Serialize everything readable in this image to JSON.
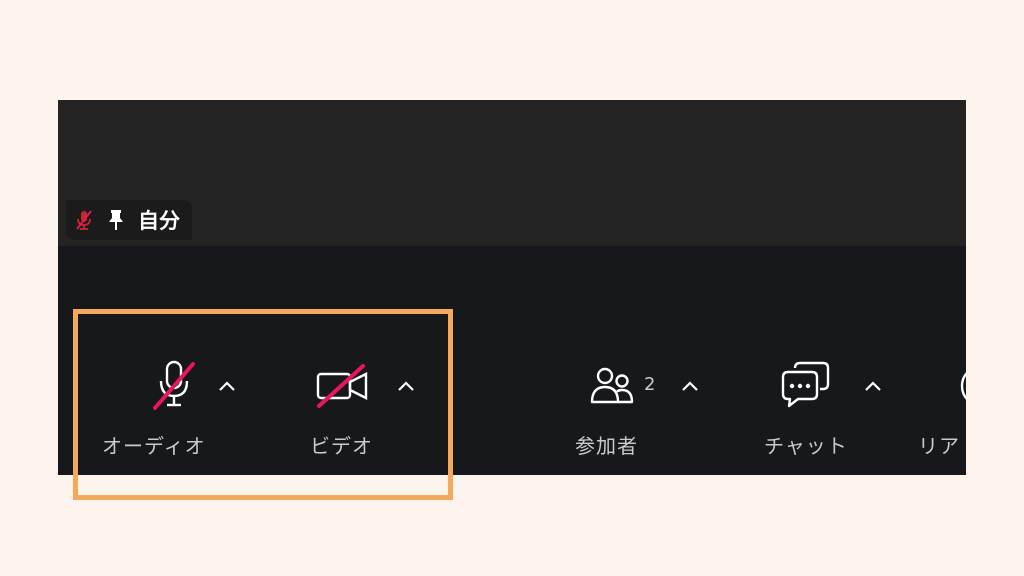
{
  "self_tile": {
    "name": "自分",
    "icons": [
      "mic-off-icon",
      "pin-icon"
    ]
  },
  "toolbar": {
    "audio": {
      "label": "オーディオ",
      "icon": "mic-off-icon",
      "caret": "chevron-up-icon"
    },
    "video": {
      "label": "ビデオ",
      "icon": "camera-off-icon",
      "caret": "chevron-up-icon"
    },
    "participants": {
      "label": "参加者",
      "icon": "people-icon",
      "count": "2",
      "caret": "chevron-up-icon"
    },
    "chat": {
      "label": "チャット",
      "icon": "chat-icon",
      "caret": "chevron-up-icon"
    },
    "reactions": {
      "label": "リア",
      "icon": "reaction-icon"
    }
  },
  "colors": {
    "page_background": "#fdf4ee",
    "toolbar_background": "#17181b",
    "video_background": "#232323",
    "muted_red": "#e8175d",
    "highlight": "#f5a95a",
    "text": "#c9cacc"
  }
}
